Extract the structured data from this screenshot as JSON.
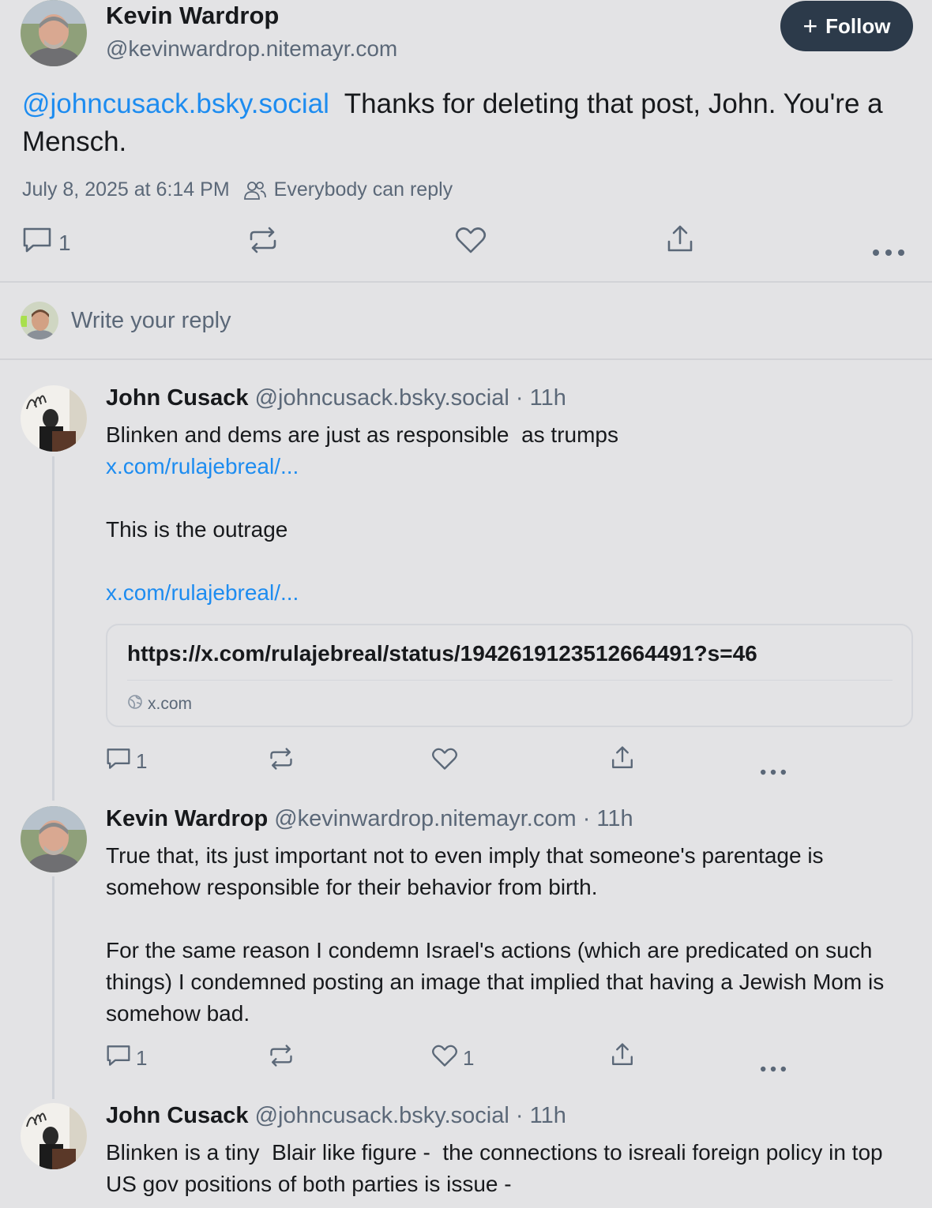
{
  "main_post": {
    "author_name": "Kevin Wardrop",
    "author_handle": "@kevinwardrop.nitemayr.com",
    "follow_label": "Follow",
    "mention": "@johncusack.bsky.social",
    "text": "  Thanks for deleting that post, John. You're a Mensch.",
    "timestamp": "July 8, 2025 at 6:14 PM",
    "reply_setting": "Everybody can reply",
    "reply_count": "1"
  },
  "composer": {
    "placeholder": "Write your reply"
  },
  "replies": [
    {
      "author_name": "John Cusack",
      "author_handle": "@johncusack.bsky.social",
      "age": "· 11h",
      "line1": "Blinken and dems are just as responsible  as trumps",
      "link1": "x.com/rulajebreal/...",
      "line2": "This is the outrage",
      "link2": "x.com/rulajebreal/...",
      "card": {
        "url": "https://x.com/rulajebreal/status/1942619123512664491?s=46",
        "domain": "x.com"
      },
      "reply_count": "1",
      "like_count": ""
    },
    {
      "author_name": "Kevin Wardrop",
      "author_handle": "@kevinwardrop.nitemayr.com",
      "age": "· 11h",
      "para1": "True that, its just important not to even imply that someone's parentage is somehow responsible for their behavior from birth.",
      "para2": "For the same reason I condemn Israel's actions (which are predicated on such things) I condemned posting an image that implied that having a Jewish Mom is somehow bad.",
      "reply_count": "1",
      "like_count": "1"
    },
    {
      "author_name": "John Cusack",
      "author_handle": "@johncusack.bsky.social",
      "age": "· 11h",
      "para1": "Blinken is a tiny  Blair like figure -  the connections to isreali foreign policy in top US gov positions of both parties is issue -"
    }
  ],
  "colors": {
    "background": "#e3e3e5",
    "link": "#1d8cf0",
    "muted": "#5b6878",
    "follow_button": "#2c3a4a"
  }
}
